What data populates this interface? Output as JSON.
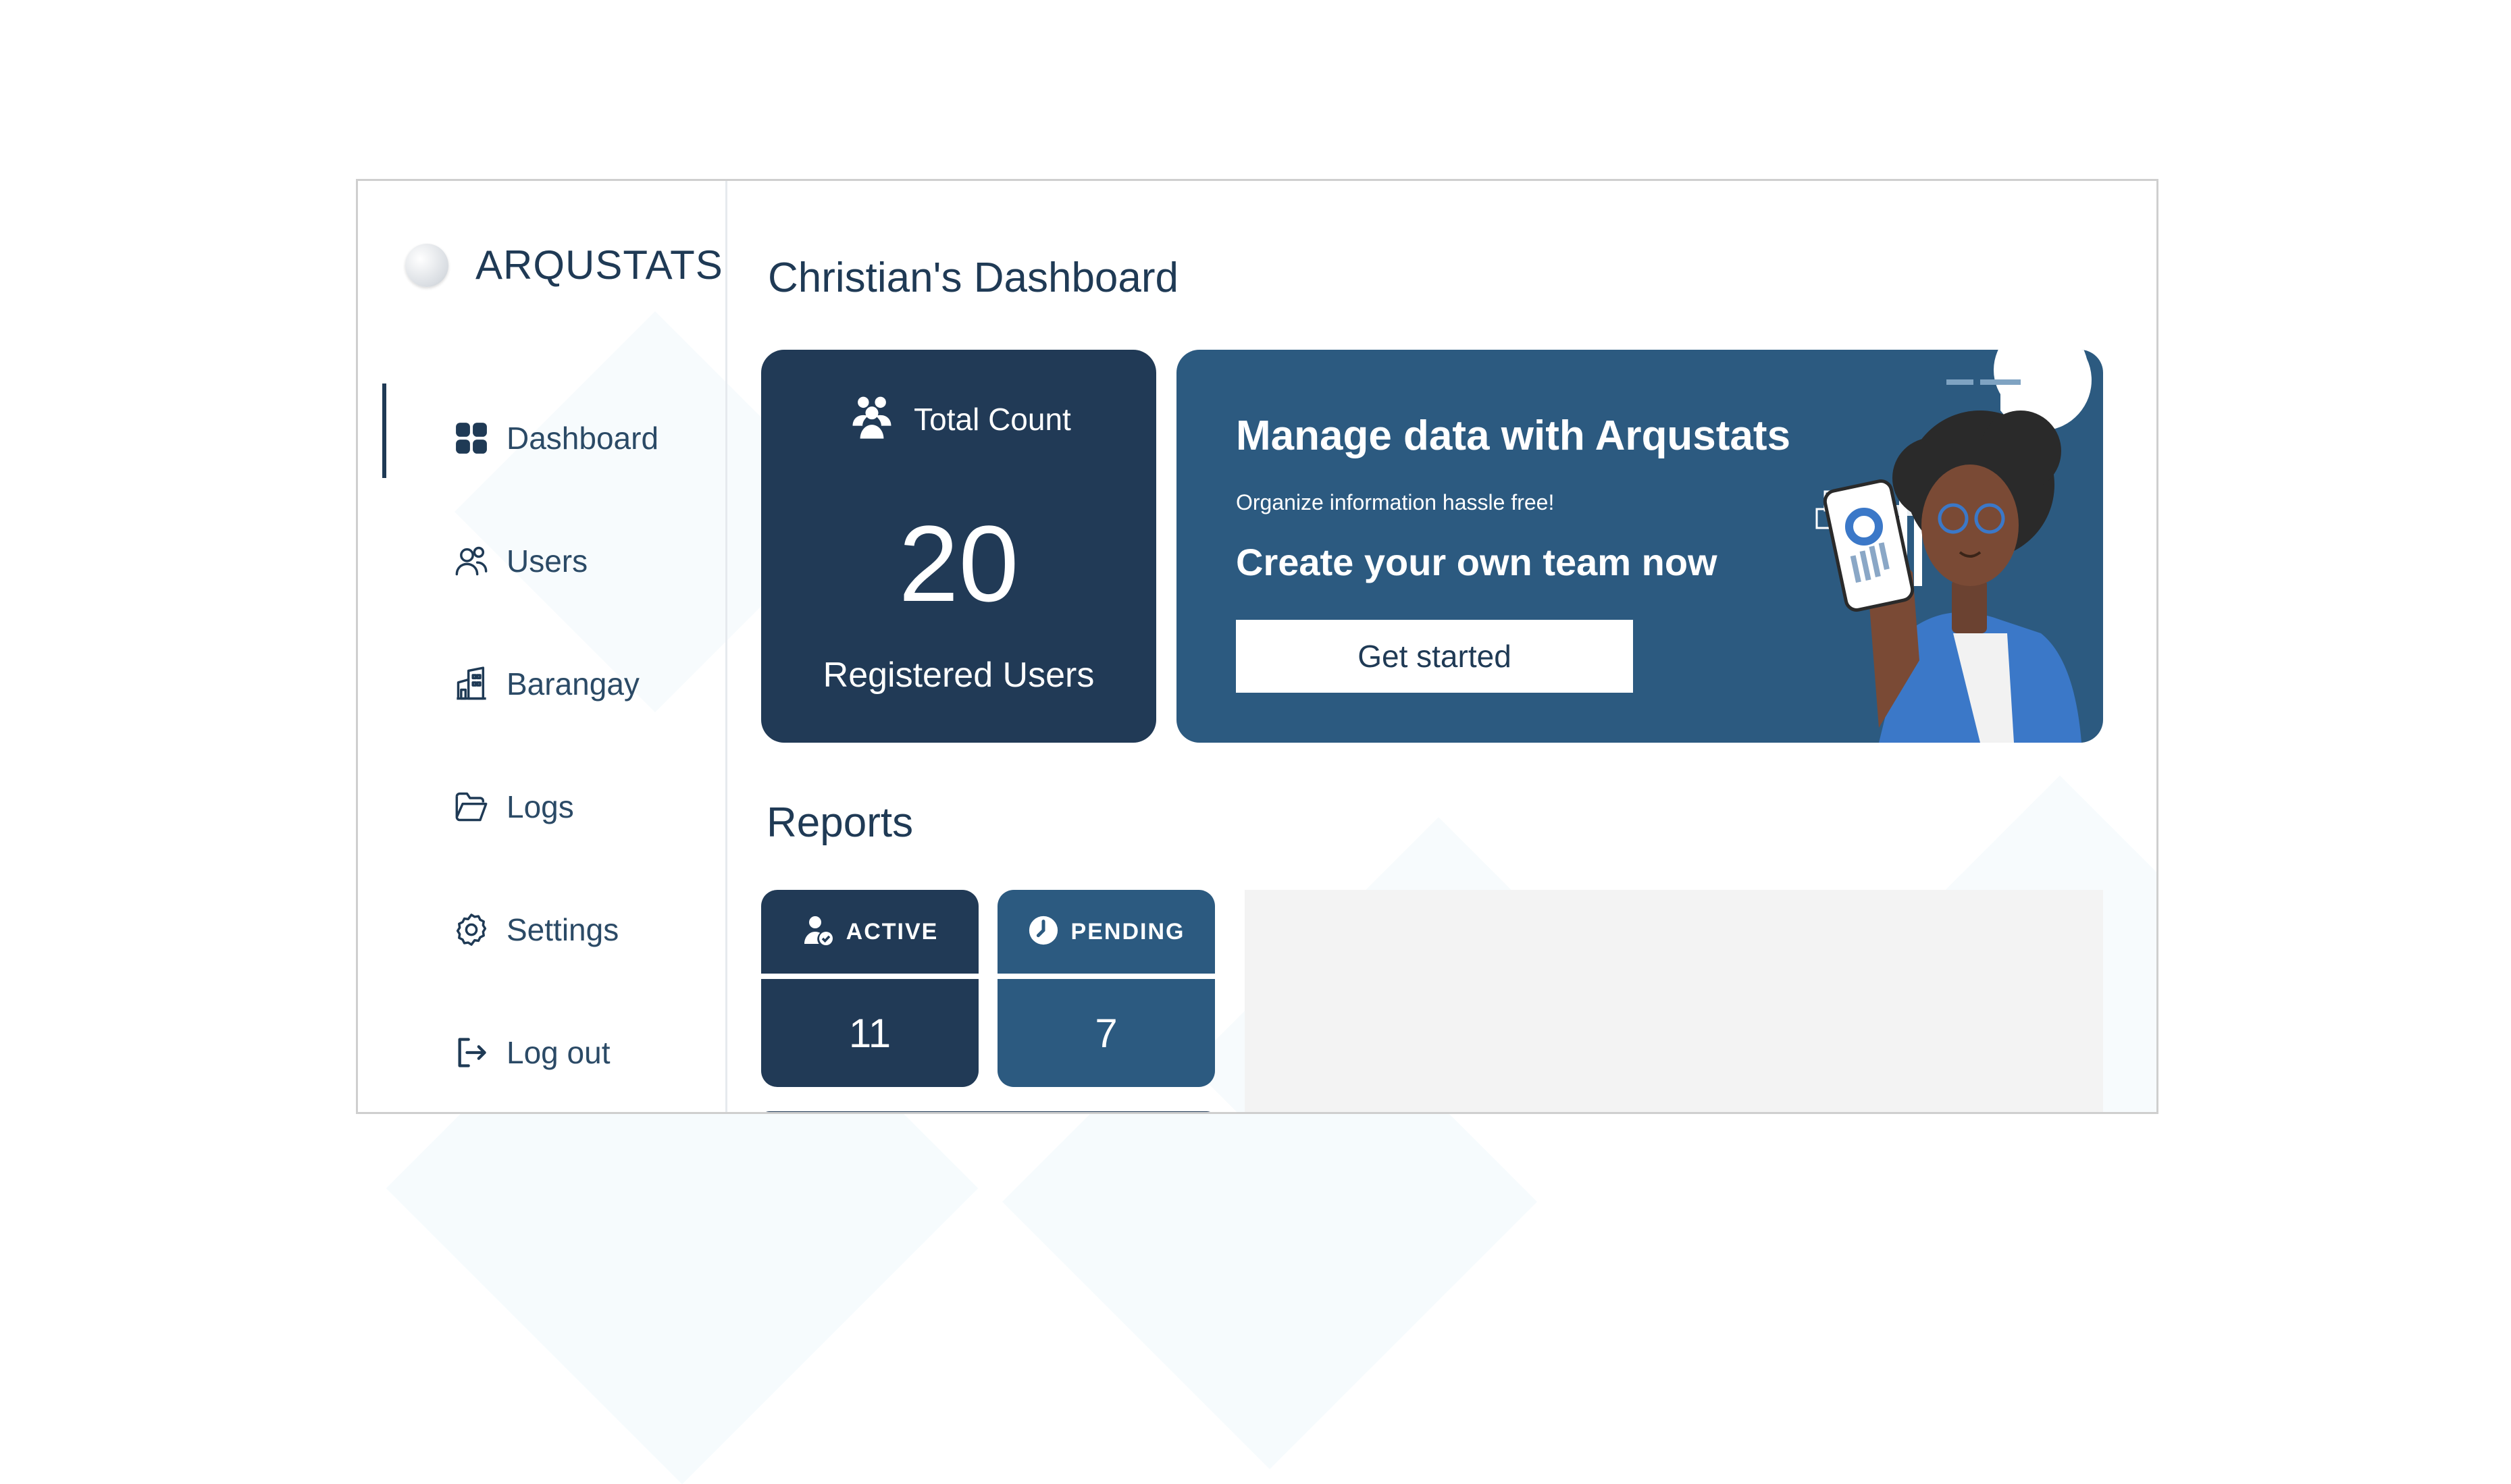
{
  "app": {
    "brand_name": "ARQUSTATS"
  },
  "sidebar": {
    "items": [
      {
        "label": "Dashboard",
        "icon": "grid-icon",
        "active": true
      },
      {
        "label": "Users",
        "icon": "users-icon"
      },
      {
        "label": "Barangay",
        "icon": "building-icon"
      },
      {
        "label": "Logs",
        "icon": "folder-icon"
      },
      {
        "label": "Settings",
        "icon": "gear-icon"
      },
      {
        "label": "Log out",
        "icon": "logout-icon"
      }
    ]
  },
  "main": {
    "title": "Christian's Dashboard",
    "count_card": {
      "label": "Total Count",
      "value": "20",
      "sub_label": "Registered Users",
      "icon": "group-icon"
    },
    "promo": {
      "title": "Manage data with Arqustats",
      "subtitle": "Organize information hassle free!",
      "cta_text": "Create your own team now",
      "button_label": "Get started"
    },
    "reports": {
      "title": "Reports",
      "stats": [
        {
          "label": "ACTIVE",
          "value": "11",
          "icon": "user-check-icon"
        },
        {
          "label": "PENDING",
          "value": "7",
          "icon": "clock-icon"
        }
      ]
    }
  },
  "colors": {
    "dark_navy": "#213a56",
    "steel_blue": "#2c5a80",
    "text": "#1f3a55",
    "panel_gray": "#f3f3f3"
  }
}
